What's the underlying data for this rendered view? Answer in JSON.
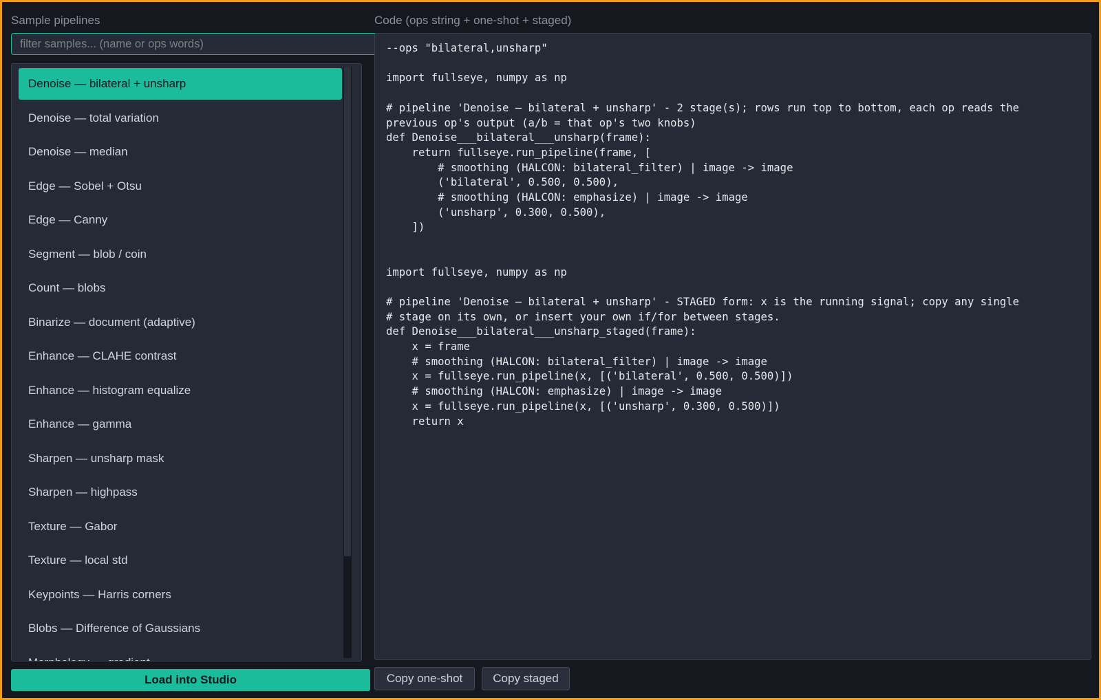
{
  "samples": {
    "title": "Sample pipelines",
    "filter_placeholder": "filter samples... (name or ops words)",
    "items": [
      {
        "label": "Denoise — bilateral + unsharp",
        "selected": true
      },
      {
        "label": "Denoise — total variation",
        "selected": false
      },
      {
        "label": "Denoise — median",
        "selected": false
      },
      {
        "label": "Edge — Sobel + Otsu",
        "selected": false
      },
      {
        "label": "Edge — Canny",
        "selected": false
      },
      {
        "label": "Segment — blob / coin",
        "selected": false
      },
      {
        "label": "Count — blobs",
        "selected": false
      },
      {
        "label": "Binarize — document (adaptive)",
        "selected": false
      },
      {
        "label": "Enhance — CLAHE contrast",
        "selected": false
      },
      {
        "label": "Enhance — histogram equalize",
        "selected": false
      },
      {
        "label": "Enhance — gamma",
        "selected": false
      },
      {
        "label": "Sharpen — unsharp mask",
        "selected": false
      },
      {
        "label": "Sharpen — highpass",
        "selected": false
      },
      {
        "label": "Texture — Gabor",
        "selected": false
      },
      {
        "label": "Texture — local std",
        "selected": false
      },
      {
        "label": "Keypoints — Harris corners",
        "selected": false
      },
      {
        "label": "Blobs — Difference of Gaussians",
        "selected": false
      },
      {
        "label": "Morphology — gradient",
        "selected": false
      }
    ],
    "load_button": "Load into Studio"
  },
  "code": {
    "title": "Code (ops string + one-shot + staged)",
    "text": "--ops \"bilateral,unsharp\"\n\nimport fullseye, numpy as np\n\n# pipeline 'Denoise — bilateral + unsharp' - 2 stage(s); rows run top to bottom, each op reads the\nprevious op's output (a/b = that op's two knobs)\ndef Denoise___bilateral___unsharp(frame):\n    return fullseye.run_pipeline(frame, [\n        # smoothing (HALCON: bilateral_filter) | image -> image\n        ('bilateral', 0.500, 0.500),\n        # smoothing (HALCON: emphasize) | image -> image\n        ('unsharp', 0.300, 0.500),\n    ])\n\n\nimport fullseye, numpy as np\n\n# pipeline 'Denoise — bilateral + unsharp' - STAGED form: x is the running signal; copy any single\n# stage on its own, or insert your own if/for between stages.\ndef Denoise___bilateral___unsharp_staged(frame):\n    x = frame\n    # smoothing (HALCON: bilateral_filter) | image -> image\n    x = fullseye.run_pipeline(x, [('bilateral', 0.500, 0.500)])\n    # smoothing (HALCON: emphasize) | image -> image\n    x = fullseye.run_pipeline(x, [('unsharp', 0.300, 0.500)])\n    return x",
    "copy_oneshot": "Copy one-shot",
    "copy_staged": "Copy staged"
  },
  "colors": {
    "accent": "#1abc9c",
    "frame_border": "#f39c12",
    "background": "#15181f",
    "panel": "#252a36"
  }
}
